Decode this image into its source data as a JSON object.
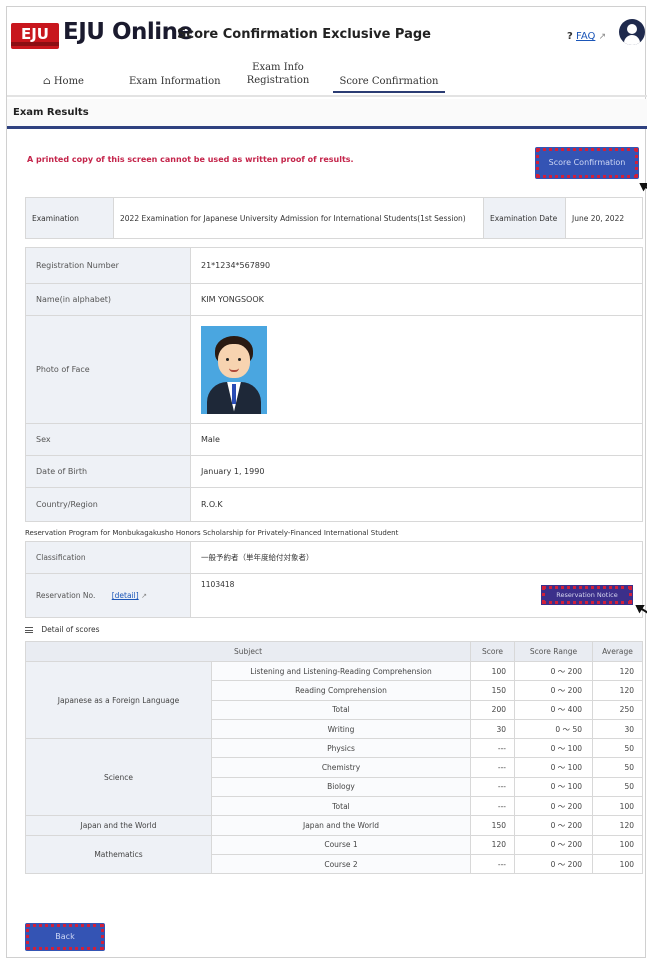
{
  "header": {
    "logo": "EJU",
    "brand": "EJU Online",
    "subtitle": "Score Confirmation Exclusive Page",
    "faq_label": "FAQ"
  },
  "nav": {
    "home": "Home",
    "exam_info": "Exam Information",
    "exam_info_reg_line1": "Exam Info",
    "exam_info_reg_line2": "Registration",
    "score_confirmation": "Score Confirmation"
  },
  "section_title": "Exam Results",
  "warning": "A printed copy of this screen cannot be used as written proof of results.",
  "score_confirmation_button": "Score Confirmation",
  "exam": {
    "exam_label": "Examination",
    "exam_value": "2022 Examination for Japanese University Admission for International Students(1st Session)",
    "date_label": "Examination Date",
    "date_value": "June 20, 2022"
  },
  "profile": {
    "reg_label": "Registration Number",
    "reg_value": "21*1234*567890",
    "name_label": "Name(in alphabet)",
    "name_value": "KIM YONGSOOK",
    "photo_label": "Photo of Face",
    "sex_label": "Sex",
    "sex_value": "Male",
    "dob_label": "Date of Birth",
    "dob_value": "January 1, 1990",
    "country_label": "Country/Region",
    "country_value": "R.O.K"
  },
  "reservation": {
    "caption": "Reservation Program for Monbukagakusho Honors Scholarship for Privately-Financed International Student",
    "class_label": "Classification",
    "class_value": "一般予約者（単年度給付対象者）",
    "no_label": "Reservation No.",
    "detail_link": "[detail]",
    "no_value": "1103418",
    "notice_button": "Reservation Notice"
  },
  "scores": {
    "caption": "Detail of scores",
    "headers": [
      "Subject",
      "Score",
      "Score Range",
      "Average"
    ],
    "groups": {
      "jfl": "Japanese as a Foreign Language",
      "science": "Science",
      "jw": "Japan and the World",
      "math": "Mathematics"
    },
    "rows": [
      {
        "sub": "Listening and Listening-Reading Comprehension",
        "score": "100",
        "range": "0 ～ 200",
        "avg": "120"
      },
      {
        "sub": "Reading Comprehension",
        "score": "150",
        "range": "0 ～ 200",
        "avg": "120"
      },
      {
        "sub": "Total",
        "score": "200",
        "range": "0 ～ 400",
        "avg": "250"
      },
      {
        "sub": "Writing",
        "score": "30",
        "range": "0 ～ 50",
        "avg": "30"
      },
      {
        "sub": "Physics",
        "score": "---",
        "range": "0 ～ 100",
        "avg": "50"
      },
      {
        "sub": "Chemistry",
        "score": "---",
        "range": "0 ～ 100",
        "avg": "50"
      },
      {
        "sub": "Biology",
        "score": "---",
        "range": "0 ～ 100",
        "avg": "50"
      },
      {
        "sub": "Total",
        "score": "---",
        "range": "0 ～ 200",
        "avg": "100"
      },
      {
        "sub": "Japan and the World",
        "score": "150",
        "range": "0 ～ 200",
        "avg": "120"
      },
      {
        "sub": "Course 1",
        "score": "120",
        "range": "0 ～ 200",
        "avg": "100"
      },
      {
        "sub": "Course 2",
        "score": "---",
        "range": "0 ～ 200",
        "avg": "100"
      }
    ]
  },
  "back_button": "Back",
  "icons": {
    "home": "home-icon",
    "faq": "question-icon",
    "external": "external-link-icon",
    "user": "user-icon",
    "list": "list-icon"
  },
  "colors": {
    "accent": "#2f4180",
    "button": "#3454b4",
    "warning": "#c4244a",
    "logo": "#c8161d"
  }
}
